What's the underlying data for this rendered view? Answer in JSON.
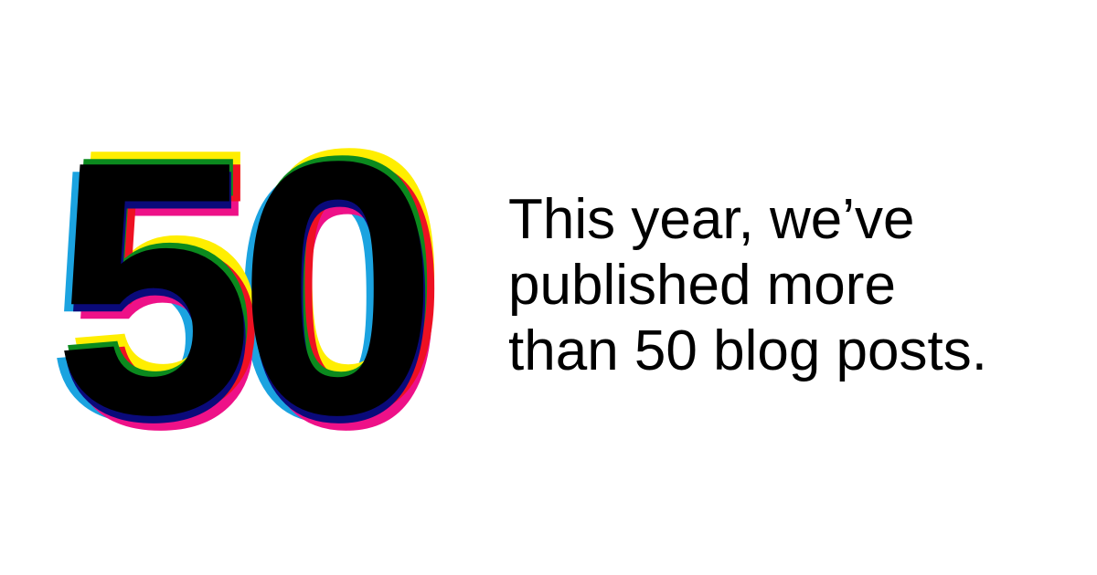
{
  "headline_number": "50",
  "message_lines": [
    "This year, we’ve",
    "published more",
    "than 50 blog posts."
  ],
  "colors": {
    "background": "#ffffff",
    "text": "#000000",
    "layer_yellow": "#ffee00",
    "layer_cyan": "#1ba3e0",
    "layer_green": "#0b8a1e",
    "layer_red": "#ee1122",
    "layer_magenta": "#ee1188",
    "layer_navy": "#0a0a7a",
    "layer_black": "#000000"
  }
}
